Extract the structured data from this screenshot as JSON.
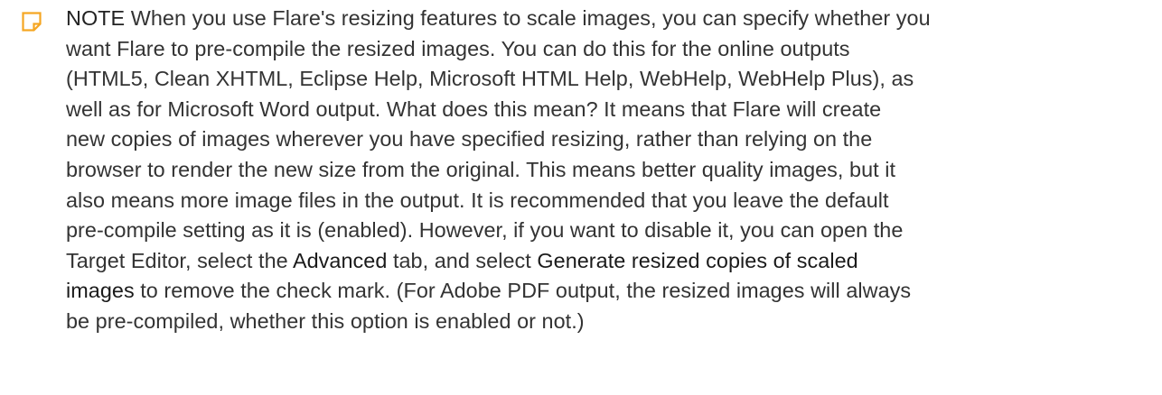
{
  "note": {
    "icon": "note-icon",
    "accent_color": "#f5a623",
    "text_color": "#333333",
    "lines": [
      [
        "NOTE",
        " When you use Flare's resizing features to scale images, you can specify whether you"
      ],
      [
        "want Flare to pre-compile the resized images. You can do this for the online outputs"
      ],
      [
        "(HTML5, Clean XHTML, Eclipse Help, Microsoft HTML Help, WebHelp, WebHelp Plus), as"
      ],
      [
        "well as for Microsoft Word output. What does this mean? It means that Flare will create"
      ],
      [
        "new copies of images wherever you have specified resizing, rather than relying on the"
      ],
      [
        "browser to render the new size from the original. This means better quality images, but it"
      ],
      [
        "also means more image files in the output. It is recommended that you leave the default"
      ],
      [
        "pre-compile setting as it is (enabled). However, if you want to disable it, you can open the"
      ],
      [
        "Target Editor, select the ",
        "Advanced",
        " tab, and select ",
        "Generate resized copies of scaled"
      ],
      [
        "images",
        " to remove the check mark. (For Adobe PDF output, the resized images will always"
      ],
      [
        "be pre-compiled, whether this option is enabled or not.)"
      ]
    ]
  }
}
